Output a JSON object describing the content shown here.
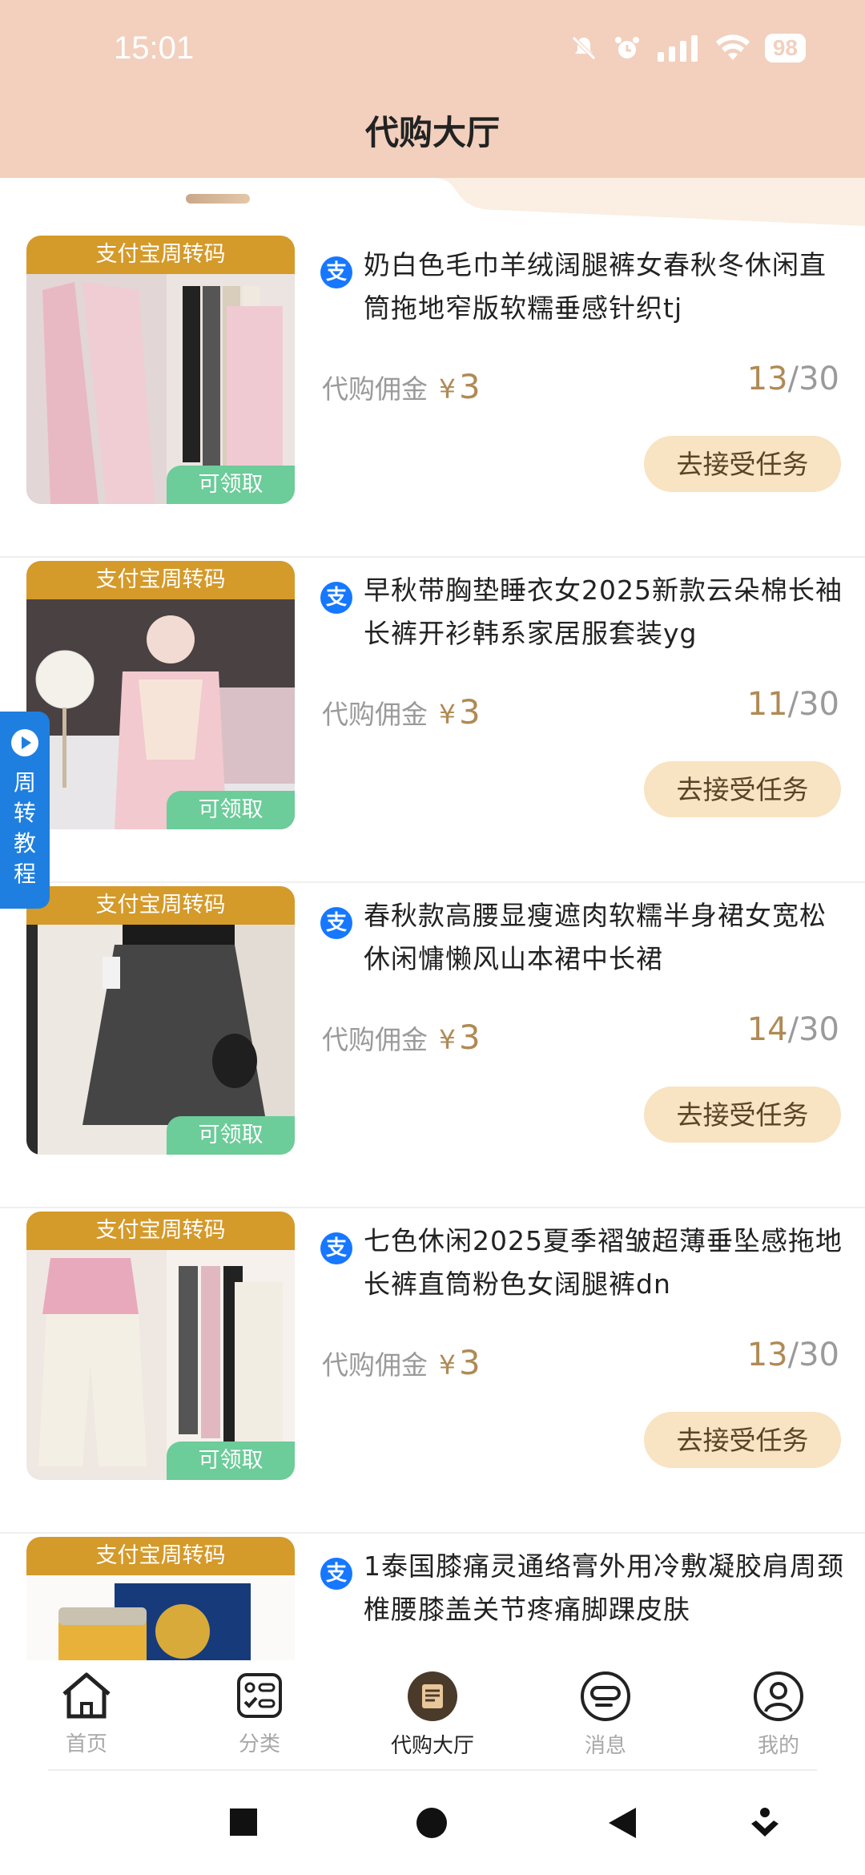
{
  "status_bar": {
    "time": "15:01",
    "battery": "98",
    "icons": [
      "mute-bell-icon",
      "alarm-icon",
      "signal-icon",
      "wifi-icon",
      "battery-icon"
    ]
  },
  "header": {
    "title": "代购大厅"
  },
  "side_tab": {
    "label_lines": [
      "周",
      "转",
      "教",
      "程"
    ],
    "icon": "play-icon"
  },
  "items": [
    {
      "banner": "支付宝周转码",
      "badge": "可领取",
      "title": "奶白色毛巾羊绒阔腿裤女春秋冬休闲直筒拖地窄版软糯垂感针织tj",
      "commission_label": "代购佣金",
      "currency": "¥",
      "commission": "3",
      "claimed": "13",
      "total": "/30",
      "button": "去接受任务"
    },
    {
      "banner": "支付宝周转码",
      "badge": "可领取",
      "title": "早秋带胸垫睡衣女2025新款云朵棉长袖长裤开衫韩系家居服套装yg",
      "commission_label": "代购佣金",
      "currency": "¥",
      "commission": "3",
      "claimed": "11",
      "total": "/30",
      "button": "去接受任务"
    },
    {
      "banner": "支付宝周转码",
      "badge": "可领取",
      "title": "春秋款高腰显瘦遮肉软糯半身裙女宽松休闲慵懒风山本裙中长裙",
      "commission_label": "代购佣金",
      "currency": "¥",
      "commission": "3",
      "claimed": "14",
      "total": "/30",
      "button": "去接受任务"
    },
    {
      "banner": "支付宝周转码",
      "badge": "可领取",
      "title": "七色休闲2025夏季褶皱超薄垂坠感拖地长裤直筒粉色女阔腿裤dn",
      "commission_label": "代购佣金",
      "currency": "¥",
      "commission": "3",
      "claimed": "13",
      "total": "/30",
      "button": "去接受任务"
    },
    {
      "banner": "支付宝周转码",
      "title": "1泰国膝痛灵通络膏外用冷敷凝胶肩周颈椎腰膝盖关节疼痛脚踝皮肤"
    }
  ],
  "bottom_nav": [
    {
      "label": "首页",
      "icon": "home-icon"
    },
    {
      "label": "分类",
      "icon": "category-icon"
    },
    {
      "label": "代购大厅",
      "icon": "purchase-hall-icon",
      "active": true
    },
    {
      "label": "消息",
      "icon": "message-icon"
    },
    {
      "label": "我的",
      "icon": "profile-icon"
    }
  ],
  "system_nav": [
    "recents-icon",
    "home-circle-icon",
    "back-icon",
    "assistant-icon"
  ],
  "colors": {
    "header_bg": "#f2d0bd",
    "banner": "#d49a2a",
    "badge": "#6ccc9a",
    "accent_gold": "#b08a55",
    "button_bg": "#f8e3c2",
    "side_tab": "#1e7fe0"
  }
}
